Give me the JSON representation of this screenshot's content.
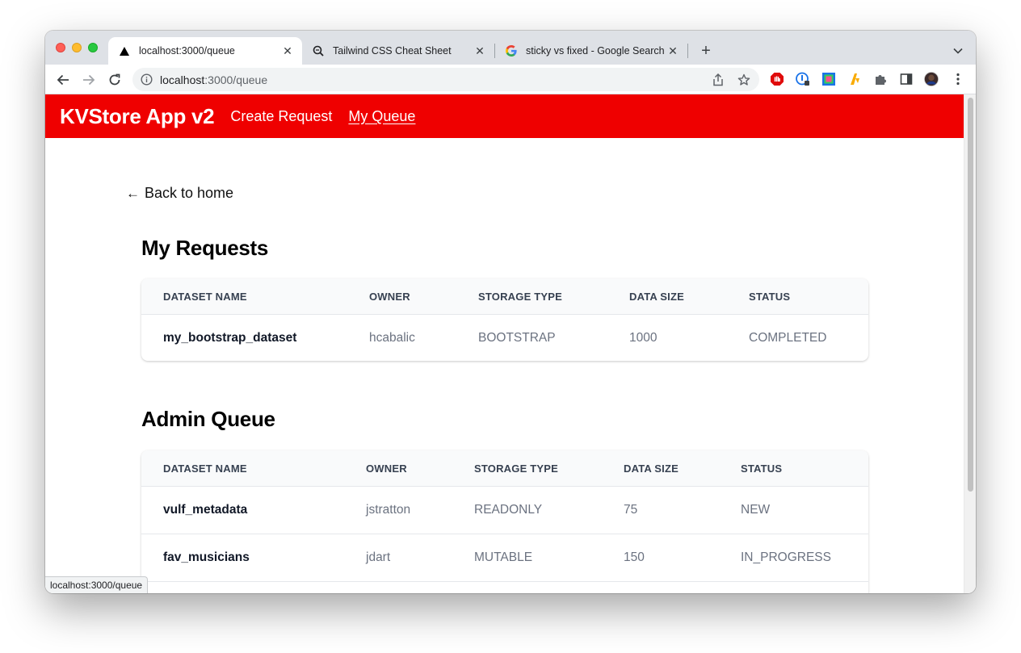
{
  "browser": {
    "tabs": [
      {
        "title": "localhost:3000/queue",
        "active": true
      },
      {
        "title": "Tailwind CSS Cheat Sheet",
        "active": false
      },
      {
        "title": "sticky vs fixed - Google Search",
        "active": false
      }
    ],
    "url_host": "localhost",
    "url_path": ":3000/queue",
    "status_url": "localhost:3000/queue"
  },
  "nav": {
    "brand": "KVStore App v2",
    "links": [
      "Create Request",
      "My Queue"
    ],
    "accent": "#ef0000"
  },
  "back_link": {
    "arrow": "←",
    "label": "Back to home"
  },
  "my_requests": {
    "title": "My Requests",
    "headers": [
      "DATASET NAME",
      "OWNER",
      "STORAGE TYPE",
      "DATA SIZE",
      "STATUS"
    ],
    "rows": [
      [
        "my_bootstrap_dataset",
        "hcabalic",
        "BOOTSTRAP",
        "1000",
        "COMPLETED"
      ]
    ]
  },
  "admin_queue": {
    "title": "Admin Queue",
    "headers": [
      "DATASET NAME",
      "OWNER",
      "STORAGE TYPE",
      "DATA SIZE",
      "STATUS"
    ],
    "rows": [
      [
        "vulf_metadata",
        "jstratton",
        "READONLY",
        "75",
        "NEW"
      ],
      [
        "fav_musicians",
        "jdart",
        "MUTABLE",
        "150",
        "IN_PROGRESS"
      ]
    ]
  }
}
